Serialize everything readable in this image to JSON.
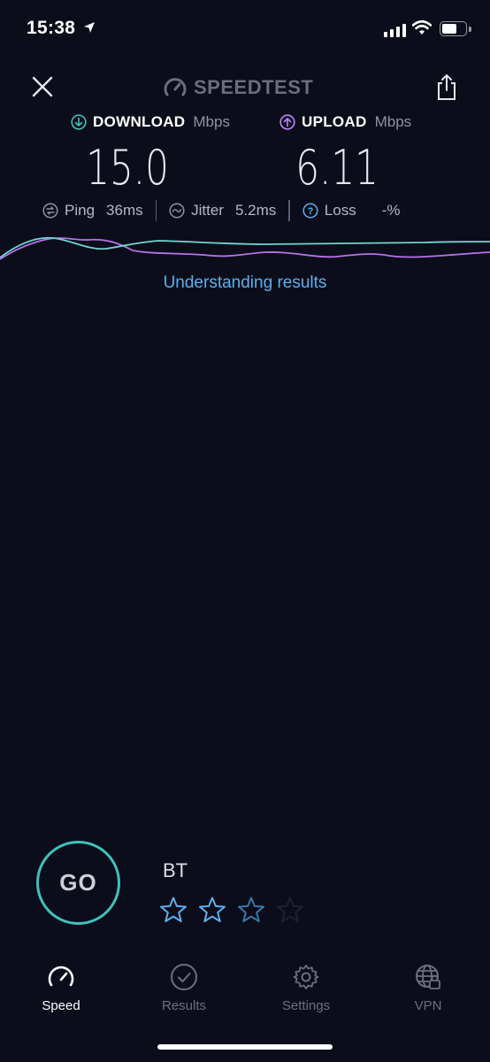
{
  "status": {
    "time": "15:38"
  },
  "header": {
    "brand": "SPEEDTEST"
  },
  "download": {
    "label": "DOWNLOAD",
    "unit": "Mbps",
    "value": "15.0",
    "color": "#3ec2bd"
  },
  "upload": {
    "label": "UPLOAD",
    "unit": "Mbps",
    "value": "6.11",
    "color": "#c084fc"
  },
  "stats": {
    "ping": {
      "label": "Ping",
      "value": "36",
      "unit": "ms"
    },
    "jitter": {
      "label": "Jitter",
      "value": "5.2",
      "unit": "ms"
    },
    "loss": {
      "label": "Loss",
      "value": "-",
      "unit": "%"
    }
  },
  "link": "Understanding results",
  "go": {
    "label": "GO"
  },
  "provider": {
    "name": "BT",
    "rating": 3,
    "rating_max": 4
  },
  "tabs": [
    {
      "label": "Speed",
      "icon": "speedometer-icon",
      "active": true
    },
    {
      "label": "Results",
      "icon": "check-circle-icon",
      "active": false
    },
    {
      "label": "Settings",
      "icon": "gear-icon",
      "active": false
    },
    {
      "label": "VPN",
      "icon": "globe-lock-icon",
      "active": false
    }
  ]
}
